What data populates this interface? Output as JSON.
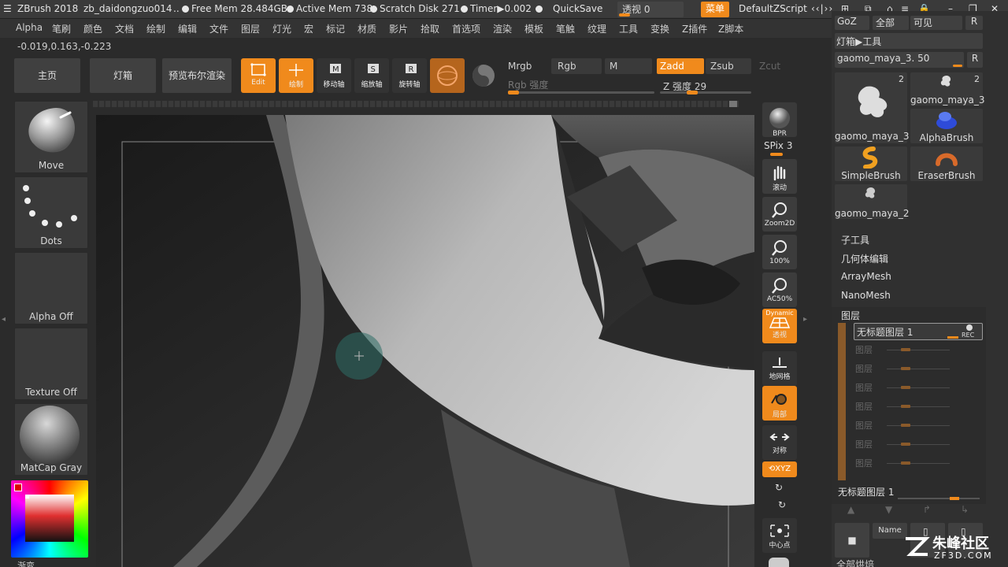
{
  "titlebar": {
    "app": "ZBrush 2018",
    "file": "zb_daidongzuo014",
    "ellipsis": "..",
    "free_mem": "Free Mem 28.484GB",
    "active_mem": "Active Mem 738",
    "scratch": "Scratch Disk 271",
    "timer": "Timer▶0.002",
    "quicksave": "QuickSave",
    "perspective": "透视 0",
    "menu": "菜单",
    "script": "DefaultZScript"
  },
  "menu": [
    "Alpha",
    "笔刷",
    "颜色",
    "文档",
    "绘制",
    "编辑",
    "文件",
    "图层",
    "灯光",
    "宏",
    "标记",
    "材质",
    "影片",
    "拾取",
    "首选项",
    "渲染",
    "模板",
    "笔触",
    "纹理",
    "工具",
    "变换",
    "Z插件",
    "Z脚本"
  ],
  "coords": "-0.019,0.163,-0.223",
  "shelf": {
    "home": "主页",
    "lightbox": "灯箱",
    "preview": "预览布尔渲染",
    "edit": "Edit",
    "draw": "绘制",
    "move": "移动轴",
    "scale": "缩放轴",
    "rotate": "旋转轴",
    "mrgb": "Mrgb",
    "rgb": "Rgb",
    "m": "M",
    "zadd": "Zadd",
    "zsub": "Zsub",
    "zcut": "Zcut",
    "rgb_intensity": "Rgb 强度",
    "z_intensity": "Z 强度 29",
    "rgb_intensity_level": 0,
    "z_intensity_level": 29
  },
  "left": {
    "brush": "Move",
    "stroke": "Dots",
    "alpha": "Alpha Off",
    "texture": "Texture Off",
    "material": "MatCap Gray",
    "gradient": "渐变"
  },
  "rtools": {
    "bpr": "BPR",
    "spix": "SPix 3",
    "scroll": "滚动",
    "zoom2d": "Zoom2D",
    "p100": "100%",
    "ac50": "AC50%",
    "dynamic": "Dynamic",
    "persp": "透视",
    "floor": "地网格",
    "local": "局部",
    "sym": "对称",
    "xyz": "XYZ",
    "center": "中心点"
  },
  "rpanel": {
    "goz": "GoZ",
    "all": "全部",
    "visible": "可见",
    "r": "R",
    "lightbox_tools": "灯箱▶工具",
    "current_tool": "gaomo_maya_3. 50",
    "current_tool_level": 50,
    "tools": [
      {
        "name": "gaomo_maya_3",
        "count": "2"
      },
      {
        "name": "gaomo_maya_3",
        "count": "2"
      },
      {
        "name": "AlphaBrush",
        "count": ""
      },
      {
        "name": "SimpleBrush",
        "count": ""
      },
      {
        "name": "EraserBrush",
        "count": ""
      },
      {
        "name": "gaomo_maya_2",
        "count": ""
      }
    ],
    "subtools": "子工具",
    "geometry": "几何体编辑",
    "arraymesh": "ArrayMesh",
    "nanomesh": "NanoMesh",
    "layers": "图层",
    "layer_name": "无标题图层 1",
    "rec": "REC",
    "layer_rows": [
      "图层",
      "图层",
      "图层",
      "图层",
      "图层",
      "图层",
      "图层"
    ],
    "layer_bottom": "无标题图层 1",
    "name_btn": "Name",
    "bottom": "全部烘焙"
  },
  "watermark": {
    "brand": "朱峰社区",
    "site": "ZF3D.COM"
  },
  "colors": {
    "accent": "#f08a1c",
    "panel": "#303030",
    "canvas": "#1f1f1f"
  }
}
